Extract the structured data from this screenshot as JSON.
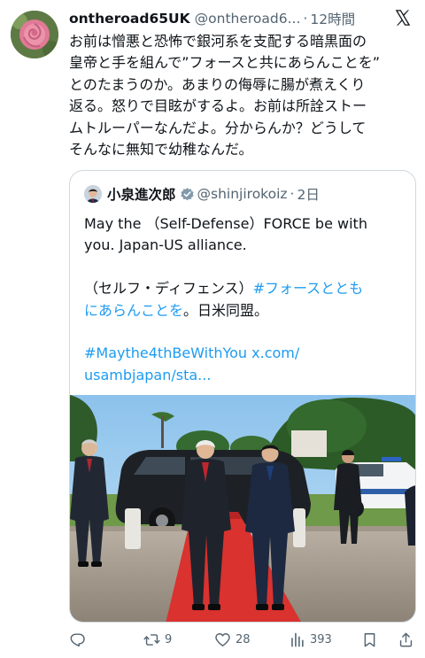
{
  "tweet": {
    "display_name": "ontheroad65UK",
    "handle": "@ontheroad6...",
    "separator": "·",
    "time": "12時間",
    "lines": [
      "お前は憎悪と恐怖で銀河系を支配する暗黒面の",
      "皇帝と手を組んで”フォースと共にあらんことを”",
      "とのたまうのか。あまりの侮辱に腸が煮えくり",
      "返る。怒りで目眩がするよ。お前は所詮ストー",
      "ムトルーパーなんだよ。分からんか？どうして",
      "そんなに無知で幼稚なんだ。"
    ]
  },
  "quote": {
    "display_name": "小泉進次郎",
    "handle": "@shinjirokoiz",
    "separator": "·",
    "time": "2日",
    "line1": "May the （Self-Defense）FORCE be with",
    "line2": "you. Japan-US alliance.",
    "jp_prefix": "（セルフ・ディフェンス）",
    "jp_hashtag_part1": "#フォースととも",
    "jp_hashtag_part2": "にあらんことを",
    "jp_suffix": "。日米同盟。",
    "hashtag": "#Maythe4thBeWithYou",
    "link_part1": "x.com/",
    "link_part2": "usambjapan/sta..."
  },
  "actions": {
    "reply_count": "",
    "retweet_count": "9",
    "like_count": "28",
    "views_count": "393"
  },
  "icons": [
    "x-logo-icon",
    "verified-badge-icon",
    "reply-icon",
    "retweet-icon",
    "like-icon",
    "views-icon",
    "bookmark-icon",
    "share-icon"
  ],
  "colors": {
    "text": "#0f1419",
    "muted": "#536471",
    "link": "#1d9bf0",
    "border": "#cfd9de",
    "verified": "#829aab"
  }
}
